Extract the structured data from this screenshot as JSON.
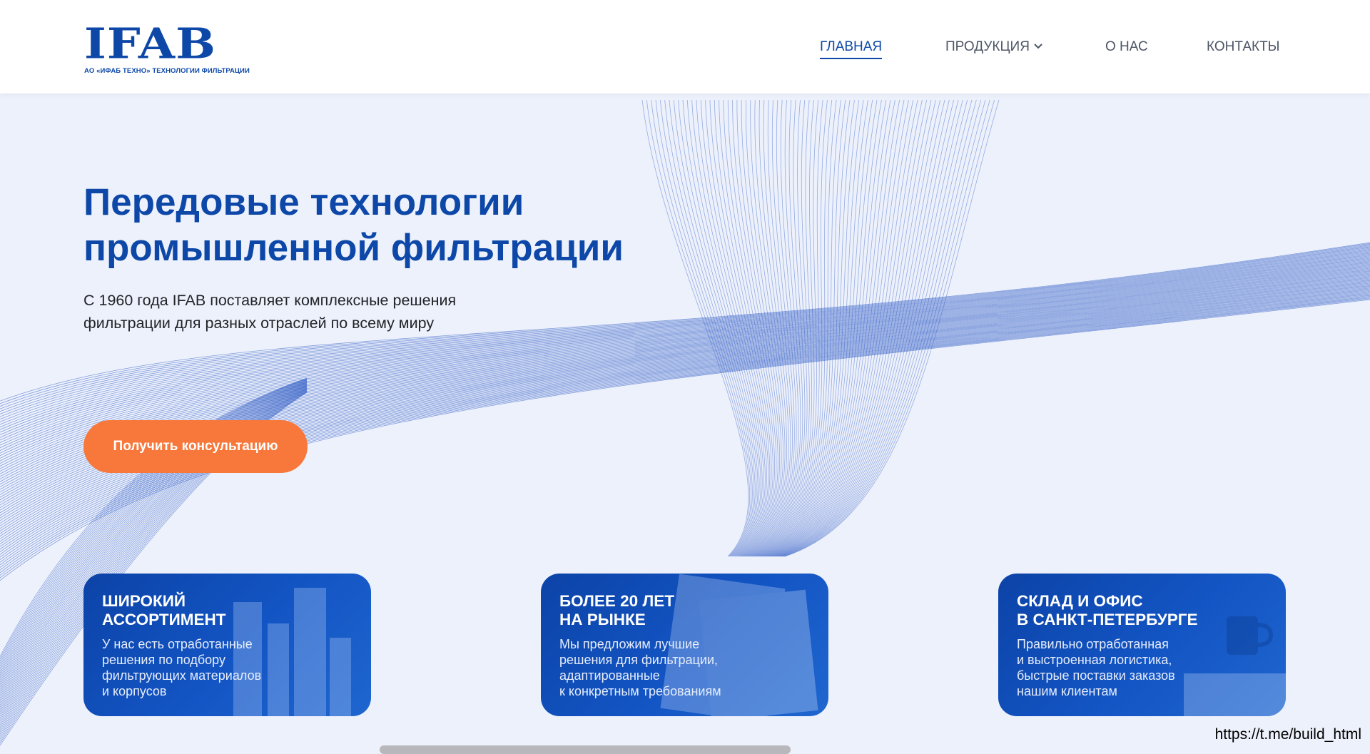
{
  "header": {
    "logo_text": "IFAB",
    "logo_subtitle": "АО «ИФАБ ТЕХНО» ТЕХНОЛОГИИ ФИЛЬТРАЦИИ",
    "nav": [
      {
        "label": "ГЛАВНАЯ",
        "active": true
      },
      {
        "label": "ПРОДУКЦИЯ",
        "has_dropdown": true
      },
      {
        "label": "О НАС"
      },
      {
        "label": "КОНТАКТЫ"
      }
    ]
  },
  "hero": {
    "title_line1": "Передовые технологии",
    "title_line2": "промышленной фильтрации",
    "subtitle_line1": "С 1960 года IFAB поставляет комплексные решения",
    "subtitle_line2": "фильтрации для разных отраслей по всему миру",
    "cta_label": "Получить консультацию"
  },
  "cards": [
    {
      "title": [
        "ШИРОКИЙ",
        "АССОРТИМЕНТ"
      ],
      "text": [
        "У нас есть отработанные",
        "решения по подбору",
        "фильтрующих материалов",
        "и корпусов"
      ],
      "bg_icon": "city-buildings"
    },
    {
      "title": [
        "БОЛЕЕ 20 ЛЕТ",
        "НА РЫНКЕ"
      ],
      "text": [
        "Мы предложим лучшие",
        "решения для фильтрации,",
        "адаптированные",
        "к конкретным требованиям"
      ],
      "bg_icon": "document-papers"
    },
    {
      "title": [
        "СКЛАД И ОФИС",
        "В САНКТ-ПЕТЕРБУРГЕ"
      ],
      "text": [
        "Правильно отработанная",
        "и выстроенная логистика,",
        "быстрые поставки заказов",
        "нашим клиентам"
      ],
      "bg_icon": "office-desk-mug"
    }
  ],
  "watermark": "https://t.me/build_html",
  "colors": {
    "brand_blue": "#0d48a8",
    "cta_orange": "#f7783a",
    "page_bg": "#edf1fb"
  }
}
